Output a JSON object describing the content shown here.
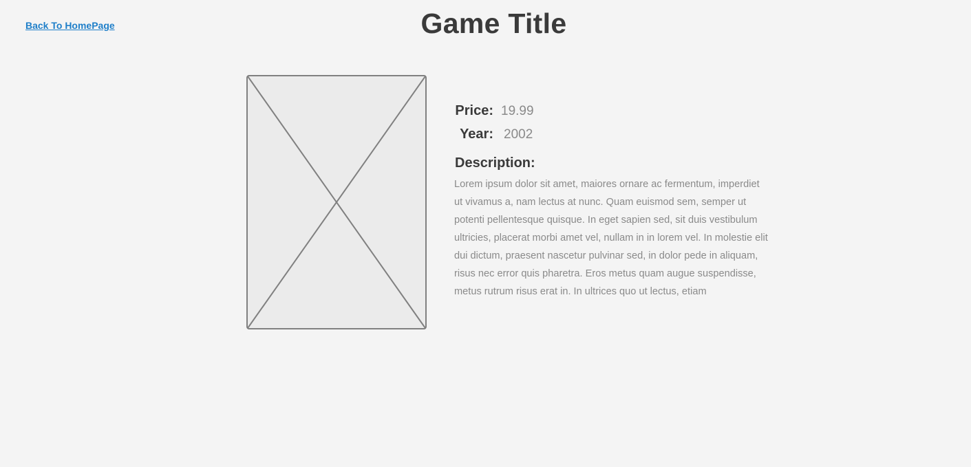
{
  "nav": {
    "back_label": "Back To HomePage"
  },
  "header": {
    "title": "Game Title"
  },
  "media": {
    "image_icon": "image-placeholder-icon"
  },
  "details": {
    "price_label": "Price:",
    "price_value": "19.99",
    "year_label": "Year:",
    "year_value": "2002",
    "description_label": "Description:",
    "description_text": "Lorem ipsum dolor sit amet, maiores ornare ac fermentum, imperdiet ut vivamus a, nam lectus at nunc. Quam euismod sem, semper ut potenti pellentesque quisque. In eget sapien sed, sit duis vestibulum ultricies, placerat morbi amet vel, nullam in in lorem vel. In molestie elit dui dictum, praesent nascetur pulvinar sed, in dolor pede in aliquam, risus nec error quis pharetra. Eros metus quam augue suspendisse, metus rutrum risus erat in. In ultrices quo ut lectus, etiam"
  },
  "colors": {
    "background": "#f4f4f4",
    "link": "#1f7fc9",
    "heading_text": "#3a3a3a",
    "muted_text": "#8a8a8a",
    "placeholder_fill": "#ebebeb",
    "placeholder_stroke": "#808080"
  }
}
